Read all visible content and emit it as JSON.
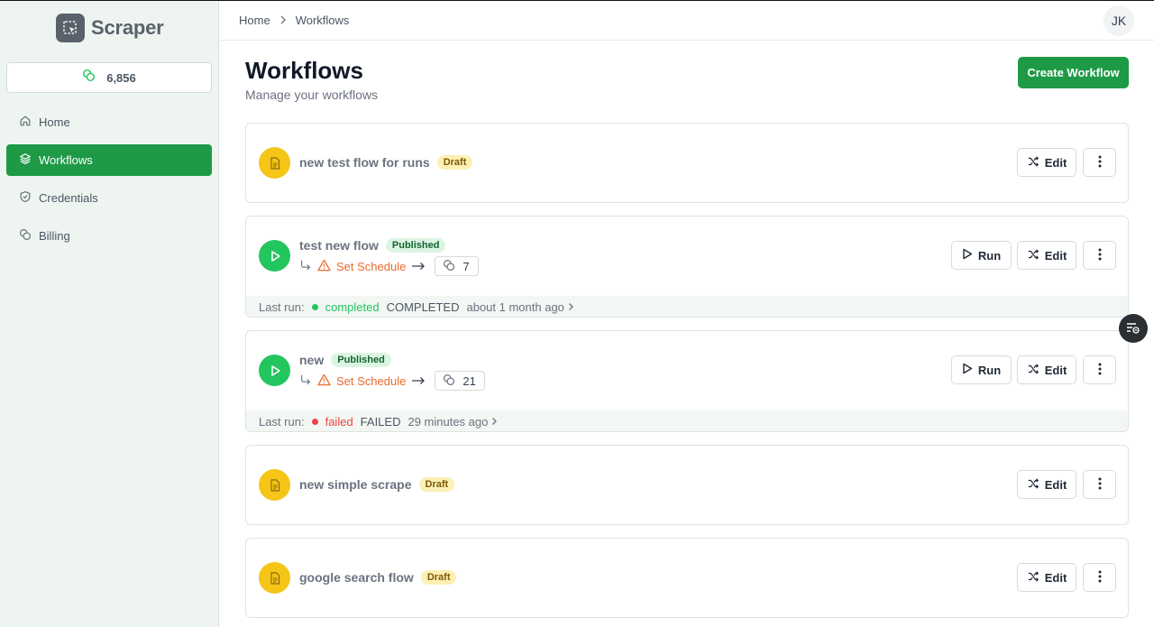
{
  "app": {
    "name": "Scraper"
  },
  "credits": {
    "value": "6,856",
    "icon": "coins-icon"
  },
  "nav": [
    {
      "label": "Home",
      "icon": "home-icon",
      "active": false
    },
    {
      "label": "Workflows",
      "icon": "layers-icon",
      "active": true
    },
    {
      "label": "Credentials",
      "icon": "shield-icon",
      "active": false
    },
    {
      "label": "Billing",
      "icon": "coins-icon",
      "active": false
    }
  ],
  "breadcrumb": {
    "home": "Home",
    "current": "Workflows"
  },
  "user": {
    "initials": "JK"
  },
  "page": {
    "title": "Workflows",
    "subtitle": "Manage your workflows",
    "create_label": "Create Workflow"
  },
  "buttons": {
    "edit": "Edit",
    "run": "Run"
  },
  "workflows": [
    {
      "name": "new test flow for runs",
      "status": "Draft"
    },
    {
      "name": "test new flow",
      "status": "Published",
      "schedule": "Set Schedule",
      "credits": "7",
      "last_run": {
        "label": "Last run:",
        "status": "completed",
        "state": "COMPLETED",
        "time": "about 1 month ago"
      }
    },
    {
      "name": "new",
      "status": "Published",
      "schedule": "Set Schedule",
      "credits": "21",
      "last_run": {
        "label": "Last run:",
        "status": "failed",
        "state": "FAILED",
        "time": "29 minutes ago"
      }
    },
    {
      "name": "new simple scrape",
      "status": "Draft"
    },
    {
      "name": "google search flow",
      "status": "Draft"
    }
  ],
  "colors": {
    "brand_green": "#1e9a47",
    "draft_yellow": "#f5c518",
    "published_green": "#22c55e",
    "schedule_orange": "#ea6a2c",
    "completed": "#22c55e",
    "failed": "#ef4444"
  }
}
